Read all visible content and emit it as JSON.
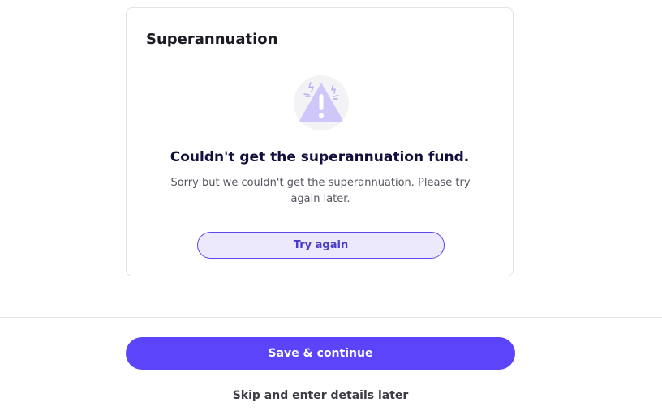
{
  "card": {
    "title": "Superannuation",
    "icon": "warning-triangle-icon",
    "error_heading": "Couldn't get the superannuation fund.",
    "error_message": "Sorry but we couldn't get the superannuation. Please try again later.",
    "try_again_label": "Try again"
  },
  "footer": {
    "save_label": "Save & continue",
    "skip_label": "Skip and enter details later"
  },
  "colors": {
    "primary": "#5b44f9",
    "try_again_bg": "#ece9fd",
    "icon_bg": "#f3f3f5",
    "icon_triangle": "#cfc7f9"
  }
}
